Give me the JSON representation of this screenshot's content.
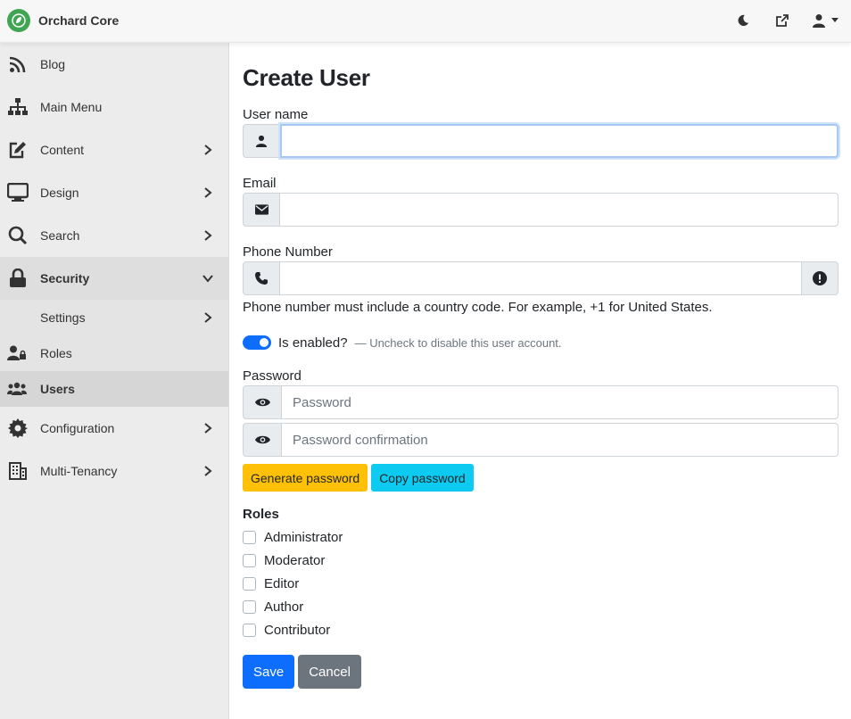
{
  "app": {
    "name": "Orchard Core"
  },
  "topbar": {
    "icons": [
      "moon-icon",
      "external-link-icon",
      "user-icon"
    ]
  },
  "sidebar": {
    "items": [
      {
        "label": "Blog",
        "icon": "rss-icon"
      },
      {
        "label": "Main Menu",
        "icon": "sitemap-icon"
      },
      {
        "label": "Content",
        "icon": "edit-icon"
      },
      {
        "label": "Design",
        "icon": "monitor-icon"
      },
      {
        "label": "Search",
        "icon": "search-icon"
      },
      {
        "label": "Security",
        "icon": "lock-icon"
      },
      {
        "label": "Settings"
      },
      {
        "label": "Roles",
        "icon": "user-lock-icon"
      },
      {
        "label": "Users",
        "icon": "users-icon"
      },
      {
        "label": "Configuration",
        "icon": "gear-icon"
      },
      {
        "label": "Multi-Tenancy",
        "icon": "building-icon"
      }
    ]
  },
  "form": {
    "title": "Create User",
    "username_label": "User name",
    "username_value": "",
    "email_label": "Email",
    "email_value": "",
    "phone_label": "Phone Number",
    "phone_value": "",
    "phone_hint": "Phone number must include a country code. For example, +1 for United States.",
    "enabled_label": "Is enabled?",
    "enabled_hint": "— Uncheck to disable this user account.",
    "enabled": true,
    "password_label": "Password",
    "password_placeholder": "Password",
    "password_confirm_placeholder": "Password confirmation",
    "generate_label": "Generate password",
    "copy_label": "Copy password",
    "roles_label": "Roles",
    "roles": [
      "Administrator",
      "Moderator",
      "Editor",
      "Author",
      "Contributor"
    ],
    "save_label": "Save",
    "cancel_label": "Cancel"
  },
  "colors": {
    "primary": "#0d6efd",
    "warning": "#ffc107",
    "info": "#0dcaf0",
    "secondary": "#6c757d",
    "brand": "#3fa552"
  }
}
